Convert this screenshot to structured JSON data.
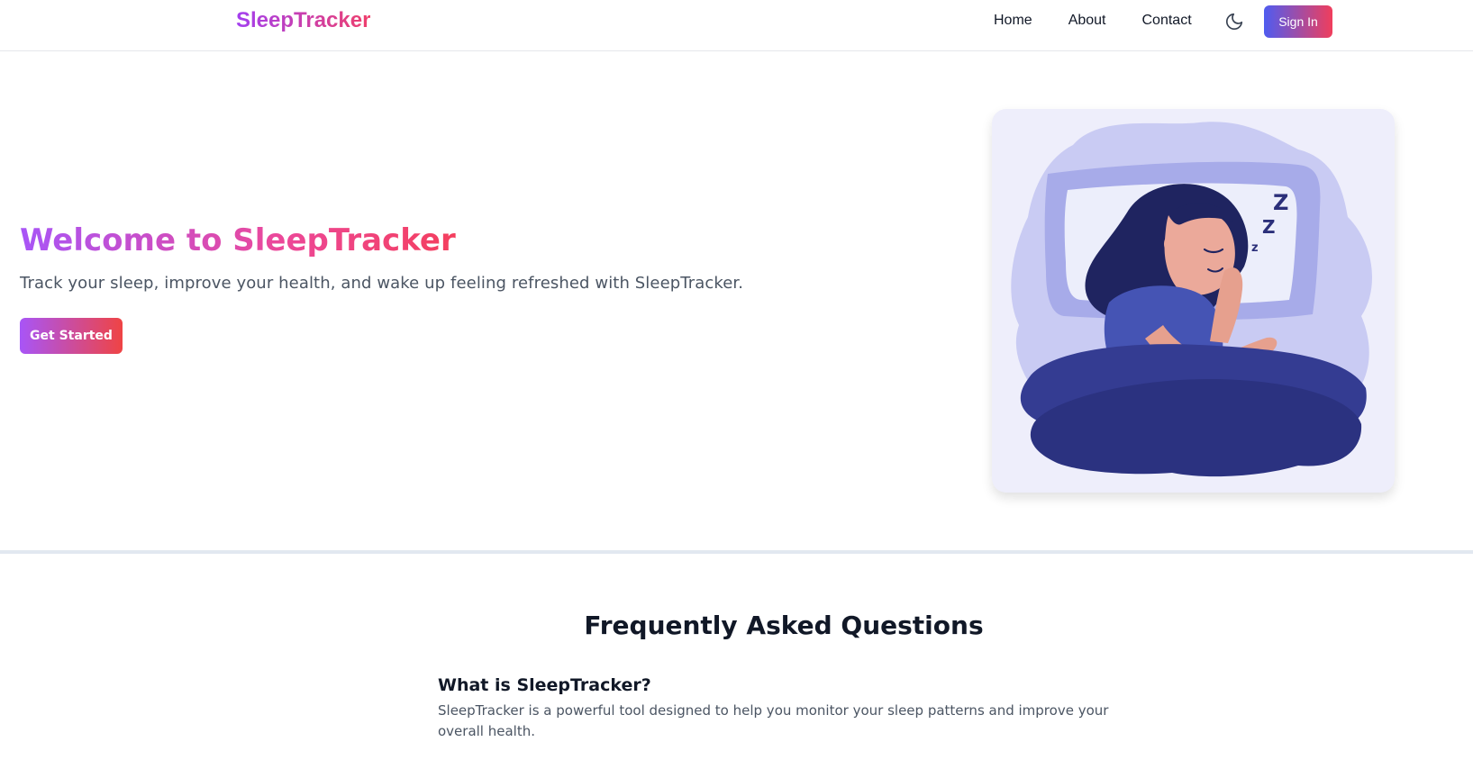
{
  "header": {
    "logo": "SleepTracker",
    "nav": [
      "Home",
      "About",
      "Contact"
    ],
    "theme_toggle_icon": "moon-icon",
    "sign_in": "Sign In"
  },
  "hero": {
    "title": "Welcome to SleepTracker",
    "subtitle": "Track your sleep, improve your health, and wake up feeling refreshed with SleepTracker.",
    "cta": "Get Started",
    "illustration": "sleeping-woman-illustration"
  },
  "faq": {
    "title": "Frequently Asked Questions",
    "items": [
      {
        "question": "What is SleepTracker?",
        "answer": "SleepTracker is a powerful tool designed to help you monitor your sleep patterns and improve your overall health."
      }
    ]
  },
  "colors": {
    "brand_gradient_start": "#a855f7",
    "brand_gradient_end": "#ef4444",
    "signin_gradient_start": "#4f5cf0",
    "signin_gradient_end": "#f03e5c",
    "illustration_bg": "#eeeefb"
  }
}
